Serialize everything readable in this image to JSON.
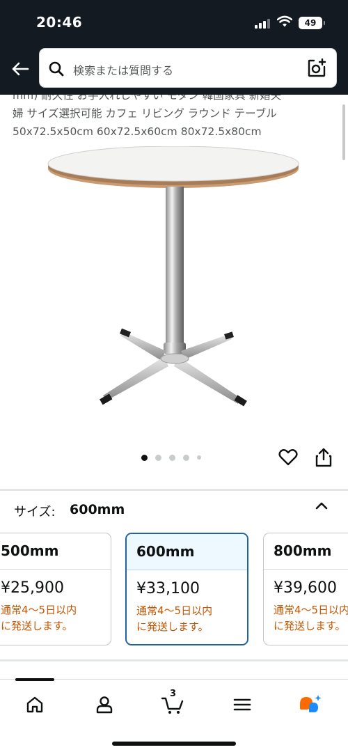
{
  "status_bar": {
    "time": "20:46",
    "battery": "49"
  },
  "search": {
    "placeholder": "検索または質問する"
  },
  "product": {
    "title_lines": [
      "mm) 耐久性 お手入れしやすい モダン 韓国家具 新婚夫",
      "婦 サイズ選択可能 カフェ リビング ラウンド テーブル",
      "50x72.5x50cm 60x72.5x60cm 80x72.5x80cm"
    ],
    "image_count": 5,
    "active_image": 0
  },
  "size_selector": {
    "label": "サイズ:",
    "selected": "600mm",
    "options": [
      {
        "size": "500mm",
        "price": "¥25,900",
        "ship1": "通常4～5日以内",
        "ship2": "に発送します。",
        "selected": false
      },
      {
        "size": "600mm",
        "price": "¥33,100",
        "ship1": "通常4～5日以内",
        "ship2": "に発送します。",
        "selected": true
      },
      {
        "size": "800mm",
        "price": "¥39,600",
        "ship1": "通常4～5日以内",
        "ship2": "に発送します。",
        "selected": false
      }
    ]
  },
  "nav": {
    "cart_count": "3"
  },
  "colors": {
    "header_bg": "#131a22",
    "selected_border": "#2162a1",
    "shipping_text": "#c45500",
    "rufus_orange": "#ff6a00",
    "rufus_blue": "#1d8cf8"
  },
  "icons": [
    "back-arrow-icon",
    "search-icon",
    "camera-icon",
    "heart-icon",
    "share-icon",
    "chevron-up-icon",
    "home-icon",
    "user-icon",
    "cart-icon",
    "menu-icon",
    "rufus-icon"
  ]
}
